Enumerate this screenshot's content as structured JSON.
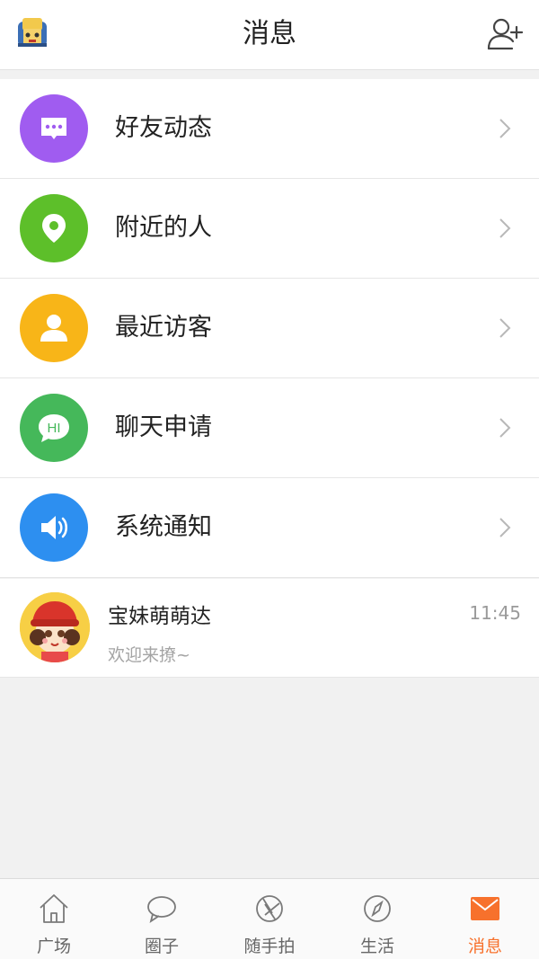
{
  "header": {
    "title": "消息"
  },
  "menu": {
    "items": [
      {
        "label": "好友动态",
        "icon": "chat-bubble-icon",
        "color": "#a05cf0"
      },
      {
        "label": "附近的人",
        "icon": "location-pin-icon",
        "color": "#5dbf2a"
      },
      {
        "label": "最近访客",
        "icon": "person-icon",
        "color": "#f8b518"
      },
      {
        "label": "聊天申请",
        "icon": "hi-bubble-icon",
        "color": "#45b85a"
      },
      {
        "label": "系统通知",
        "icon": "speaker-icon",
        "color": "#2d8ff0"
      }
    ]
  },
  "conversation": {
    "name": "宝妹萌萌达",
    "time": "11:45",
    "message": "欢迎来撩~"
  },
  "tabbar": {
    "accent": "#f7712c",
    "items": [
      {
        "label": "广场",
        "icon": "home-icon"
      },
      {
        "label": "圈子",
        "icon": "chat-icon"
      },
      {
        "label": "随手拍",
        "icon": "aperture-icon"
      },
      {
        "label": "生活",
        "icon": "compass-icon"
      },
      {
        "label": "消息",
        "icon": "mail-icon",
        "active": true
      }
    ]
  }
}
